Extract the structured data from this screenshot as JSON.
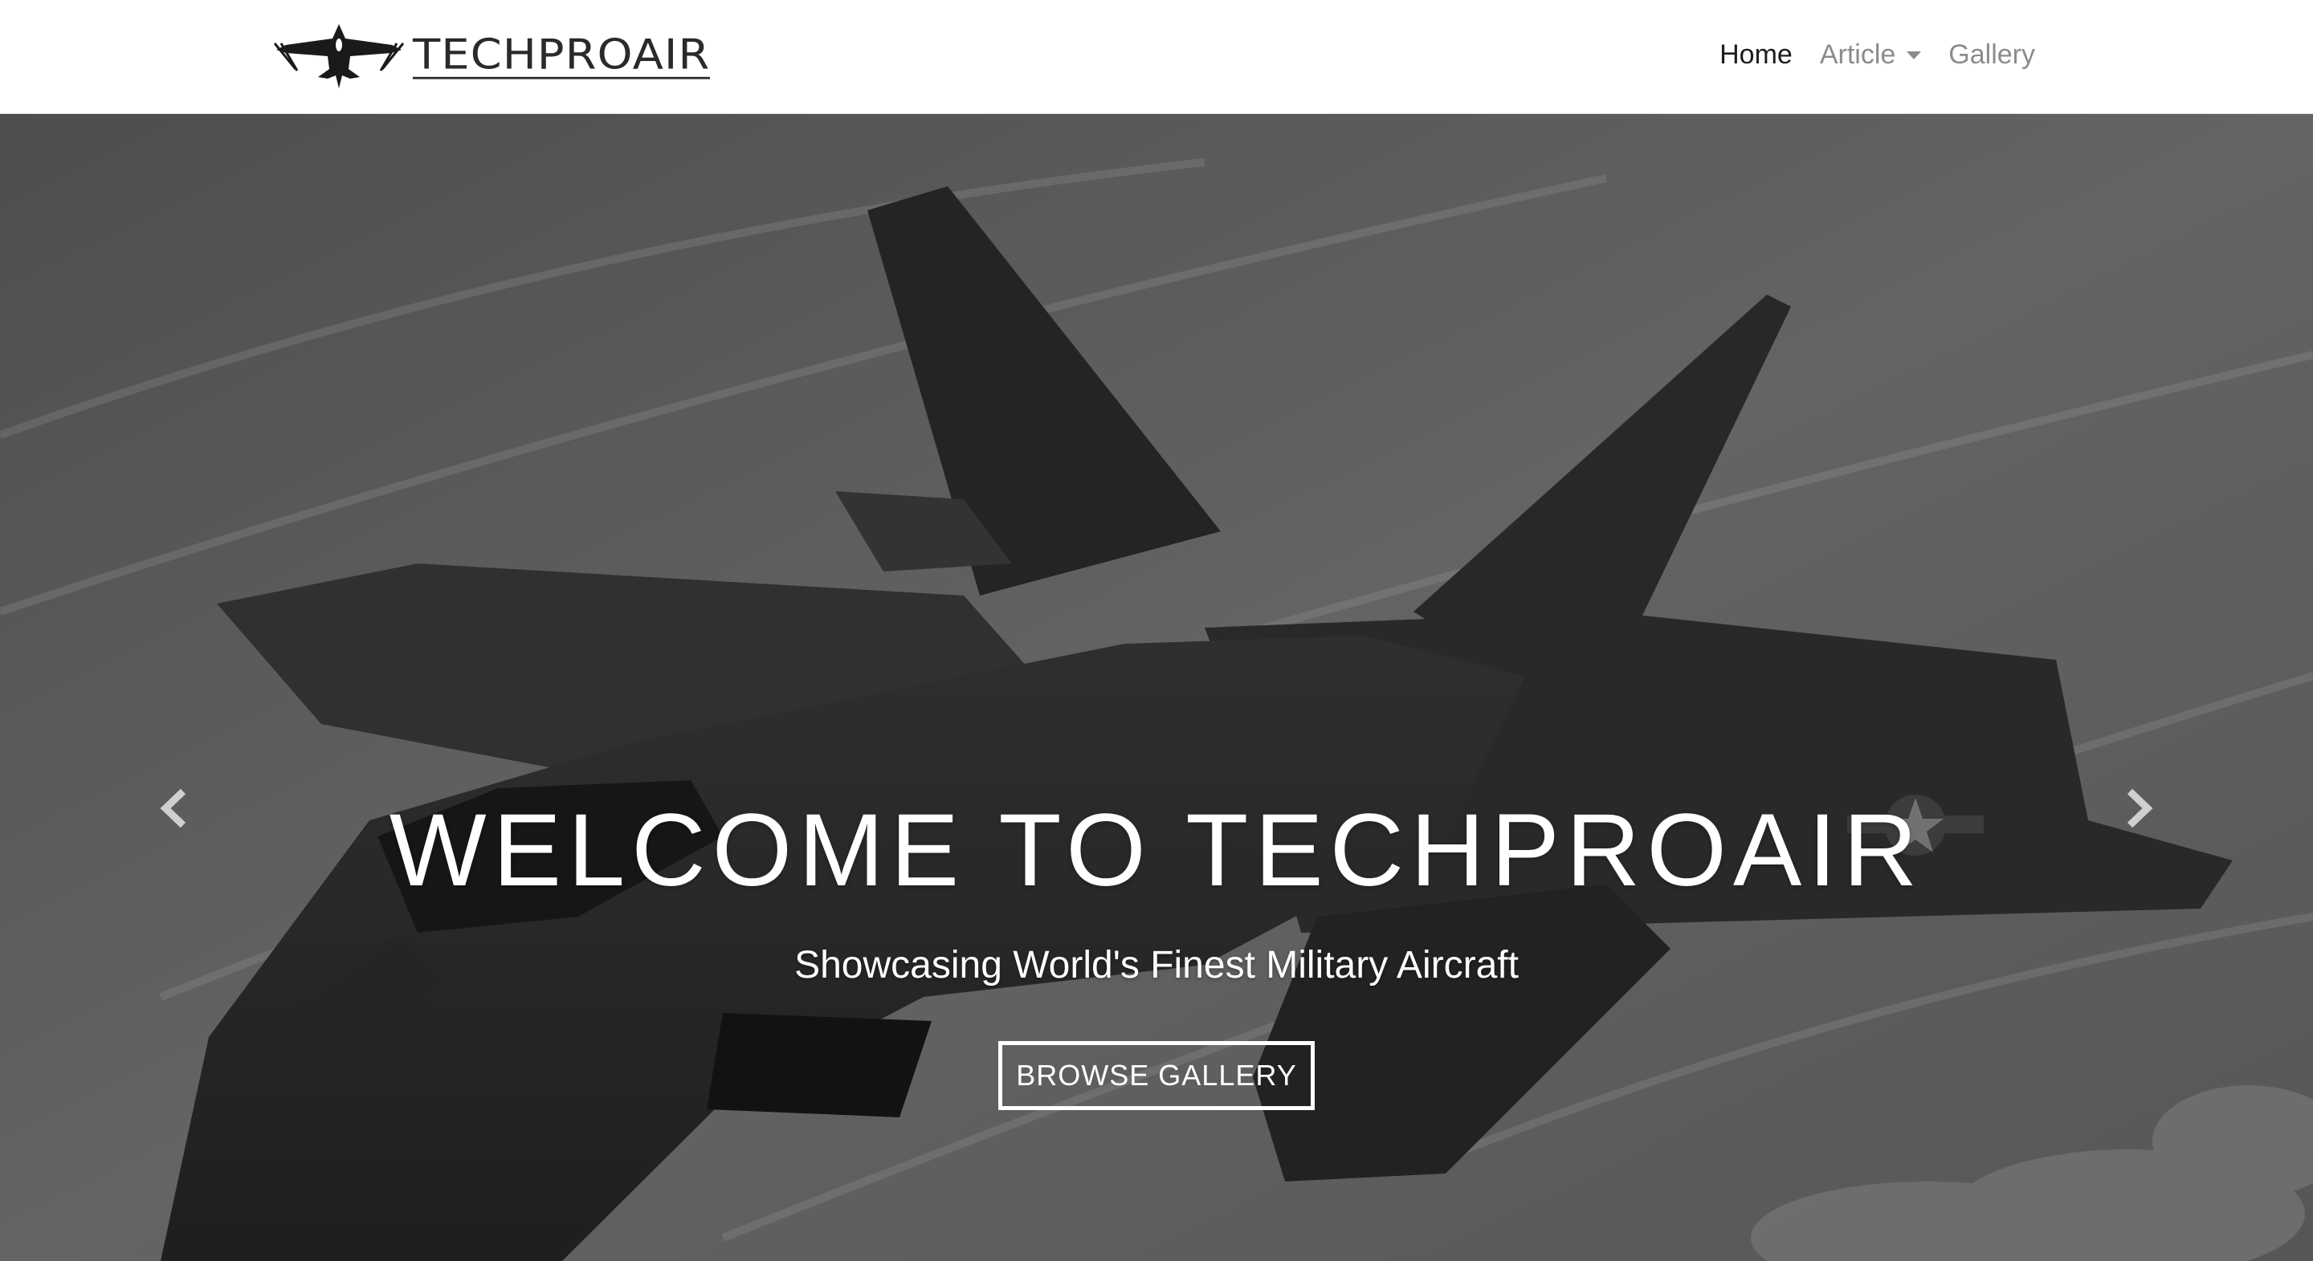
{
  "brand": {
    "name": "TECHPROAIR",
    "logo_icon": "fighter-jet-logo"
  },
  "nav": {
    "items": [
      {
        "label": "Home",
        "active": true
      },
      {
        "label": "Article",
        "dropdown": true
      },
      {
        "label": "Gallery"
      }
    ]
  },
  "hero": {
    "title": "WELCOME TO TECHPROAIR",
    "subtitle": "Showcasing World's Finest Military Aircraft",
    "button_label": "BROWSE GALLERY",
    "background": "grayscale-fighter-jet-photo",
    "prev_icon": "chevron-left-icon",
    "next_icon": "chevron-right-icon"
  },
  "colors": {
    "navbar_bg": "#ffffff",
    "nav_active": "#1c1c1c",
    "nav_inactive": "#8c8c8c",
    "hero_text": "#ffffff"
  }
}
